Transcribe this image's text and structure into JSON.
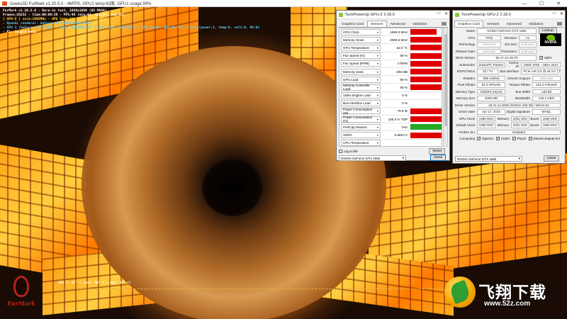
{
  "furmark_window": {
    "title": "Geeks3D FurMark v1.20.5.0 - 46FPS, GPU1 temp:63度, GPU1 usage:99%",
    "controls": [
      "—",
      "☐",
      "✕"
    ]
  },
  "overlay": {
    "line1": "FurMark v1.20.5.0 - Burn-in test, 1920x1080 (0X MSAA)",
    "line2": "Frames:26232 - time:00:09:39 - FPS:46 (min:44, max:56, avg:45)",
    "line3": "[ GPU-Z ] core:1695MHz - GPU temp:62° C - VDDC:0.881V",
    "line4": "- OpenGL renderer: GeForce GTX 1650/PCIe/SSE2",
    "line5": "- GPU 1 (GeForce GTX 1650) - core: 1695MHz:63° C:99%, mem: 4001MHz:9%, GPU power: 101.4% TDP, limits[power:1, temp:0, volt:0, OV:0]",
    "line6": "- F1: toggle help"
  },
  "sensors_window": {
    "title": "TechPowerUp GPU-Z 2.18.0",
    "tabs": [
      "Graphics Card",
      "Sensors",
      "Advanced",
      "Validation"
    ],
    "active_tab": "Sensors",
    "rows": [
      {
        "label": "GPU Clock",
        "value": "1695.0 MHz",
        "fill": 0.85,
        "color": "#e00000"
      },
      {
        "label": "Memory Clock",
        "value": "2000.5 MHz",
        "fill": 1.0,
        "color": "#e00000"
      },
      {
        "label": "GPU Temperature",
        "value": "62.0 °C",
        "fill": 1.0,
        "color": "#e00000"
      },
      {
        "label": "Fan Speed (%)",
        "value": "59 %",
        "fill": 1.0,
        "color": "#e00000"
      },
      {
        "label": "Fan Speed (RPM)",
        "value": "0 RPM",
        "fill": 1.0,
        "color": "#e00000"
      },
      {
        "label": "Memory Used",
        "value": "405 MB",
        "fill": 1.0,
        "color": "#e00000"
      },
      {
        "label": "GPU Load",
        "value": "99 %",
        "fill": 1.0,
        "color": "#e00000"
      },
      {
        "label": "Memory Controller Load",
        "value": "99 %",
        "fill": 1.0,
        "color": "#e00000"
      },
      {
        "label": "Video Engine Load",
        "value": "0 %",
        "fill": 0,
        "color": "#e00000"
      },
      {
        "label": "Bus Interface Load",
        "value": "0 %",
        "fill": 0,
        "color": "#e00000"
      },
      {
        "label": "Power Consumption (W)",
        "value": "79.5 W",
        "fill": 1.0,
        "color": "#e00000"
      },
      {
        "label": "Power Consumption (%)",
        "value": "106.0 % TDP",
        "fill": 1.0,
        "color": "#e00000"
      },
      {
        "label": "PerfCap Reason",
        "value": "Pwr",
        "fill": 1.0,
        "color": "#22a822"
      },
      {
        "label": "VDDC",
        "value": "0.8810 V",
        "fill": 1.0,
        "color": "#e00000"
      },
      {
        "label": "CPU Temperature",
        "value": "",
        "fill": 0,
        "color": "#e00000"
      }
    ],
    "log_label": "Log to file",
    "reset_label": "Reset",
    "gpu_select": "NVIDIA GeForce GTX 1650",
    "close_label": "Close"
  },
  "card_window": {
    "title": "TechPowerUp GPU-Z 2.18.0",
    "tabs": [
      "Graphics Card",
      "Sensors",
      "Advanced",
      "Validation"
    ],
    "active_tab": "Graphics Card",
    "lookup_label": "Lookup",
    "name": "NVIDIA GeForce GTX 1650",
    "gpu": "TF62",
    "revision": "A1",
    "technology": "Unknown",
    "die_size": "Unknown",
    "release_date": "Unknown",
    "transistors": "Unknown",
    "bios_version": "90.17.1C.00.F9",
    "uefi_label": "UEFI",
    "subvendor": "Zotac/PC Partner",
    "device_id": "10DE 1F82 - 19DA 2547",
    "rops_tmus": "32 / 74",
    "bus_interface": "PCIe x16 3.0 @ x8 3.0",
    "shaders": "896 Unified",
    "directx_support": "Unknown",
    "pixel_fillrate": "53.3 GPixel/s",
    "texture_fillrate": "123.2 GTexel/s",
    "memory_type": "GDDR5 (Hynix)",
    "bus_width": "128 Bit",
    "memory_size": "4096 MB",
    "bandwidth": "128.1 GB/s",
    "driver_version": "26.21.14.3039 (NVIDIA 430.39) / Win10 64",
    "driver_date": "Apr 17, 2019",
    "digital_signature": "WHQL",
    "gpu_clock": "1485 MHz",
    "memory_clock": "2001 MHz",
    "boost_clock": "1665 MHz",
    "default_clock": "1485 MHz",
    "default_memory": "2001 MHz",
    "default_boost": "1665 MHz",
    "nvidia_sli": "Disabled",
    "computing": [
      "OpenCL",
      "CUDA",
      "PhysX",
      "DirectCompute 5.0"
    ],
    "gpu_select": "NVIDIA GeForce GTX 1650",
    "close_label": "Close",
    "labels": {
      "name": "Name",
      "gpu": "GPU",
      "revision": "Revision",
      "technology": "Technology",
      "die_size": "Die Size",
      "release_date": "Release Date",
      "transistors": "Transistors",
      "bios_version": "BIOS Version",
      "subvendor": "Subvendor",
      "device_id": "Device ID",
      "rops_tmus": "ROPs/TMUs",
      "bus_interface": "Bus Interface",
      "shaders": "Shaders",
      "directx": "DirectX Support",
      "pixel_fillrate": "Pixel Fillrate",
      "texture_fillrate": "Texture Fillrate",
      "memory_type": "Memory Type",
      "bus_width": "Bus Width",
      "memory_size": "Memory Size",
      "bandwidth": "Bandwidth",
      "driver_version": "Driver Version",
      "driver_date": "Driver Date",
      "digital_signature": "Digital Signature",
      "gpu_clock": "GPU Clock",
      "memory": "Memory",
      "boost": "Boost",
      "default_clock": "Default Clock",
      "nvidia_sli": "NVIDIA SLI",
      "computing": "Computing"
    }
  },
  "graph": {
    "label": "GPU 1: 63° C (min: 40° C - max: 63° C)"
  },
  "furmark_logo": "FurMark",
  "watermark": {
    "big": "飞翔下载",
    "small": "www.52z.com"
  }
}
